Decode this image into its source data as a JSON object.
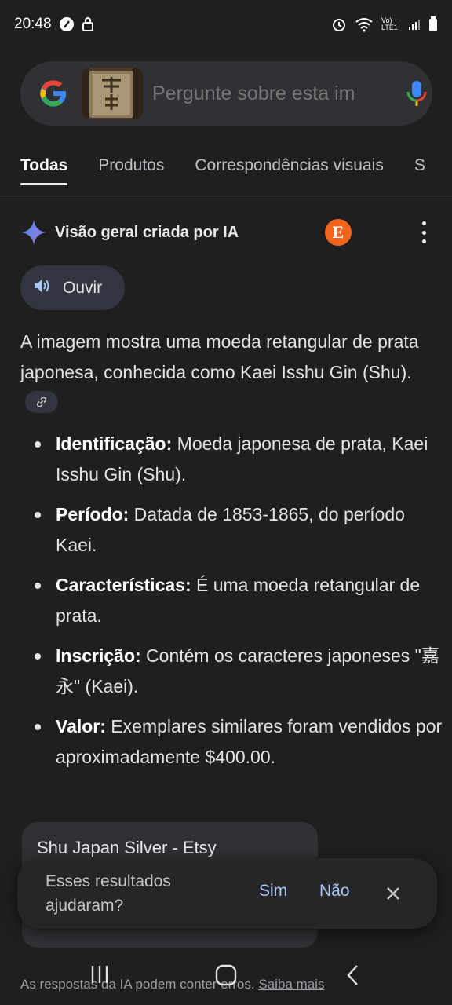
{
  "status_bar": {
    "time": "20:48",
    "network_label": "Vo) LTE1",
    "icons": [
      "data-saver-icon",
      "lock-icon",
      "alarm-icon",
      "wifi-icon",
      "signal-icon",
      "battery-icon"
    ]
  },
  "search": {
    "placeholder": "Pergunte sobre esta im",
    "icons": [
      "google-logo",
      "image-thumbnail",
      "mic-icon"
    ]
  },
  "tabs": [
    {
      "label": "Todas",
      "active": true
    },
    {
      "label": "Produtos",
      "active": false
    },
    {
      "label": "Correspondências visuais",
      "active": false
    },
    {
      "label": "S",
      "active": false
    }
  ],
  "ai_overview": {
    "title": "Visão geral criada por IA",
    "source_avatar_letter": "E",
    "listen_label": "Ouvir",
    "intro": "A imagem mostra uma moeda retangular de prata japonesa, conhecida como Kaei Isshu Gin (Shu).",
    "bullets": [
      {
        "label": "Identificação:",
        "text": " Moeda japonesa de prata, Kaei Isshu Gin (Shu)."
      },
      {
        "label": "Período:",
        "text": " Datada de 1853-1865, do período Kaei."
      },
      {
        "label": "Características:",
        "text": " É uma moeda retangular de prata."
      },
      {
        "label": "Inscrição:",
        "text": " Contém os caracteres japoneses \"嘉永\" (Kaei)."
      },
      {
        "label": "Valor:",
        "text": " Exemplares similares foram vendidos por aproximadamente $400.00."
      }
    ]
  },
  "source_card": {
    "title": "Shu Japan Silver - Etsy"
  },
  "feedback": {
    "question": "Esses resultados ajudaram?",
    "yes_label": "Sim",
    "no_label": "Não"
  },
  "footer": {
    "disclaimer": "As respostas da IA podem conter erros. ",
    "learn_more": "Saiba mais"
  },
  "colors": {
    "background": "#1f1f1f",
    "link_blue": "#a8c7fa",
    "etsy_orange": "#f1641e"
  }
}
